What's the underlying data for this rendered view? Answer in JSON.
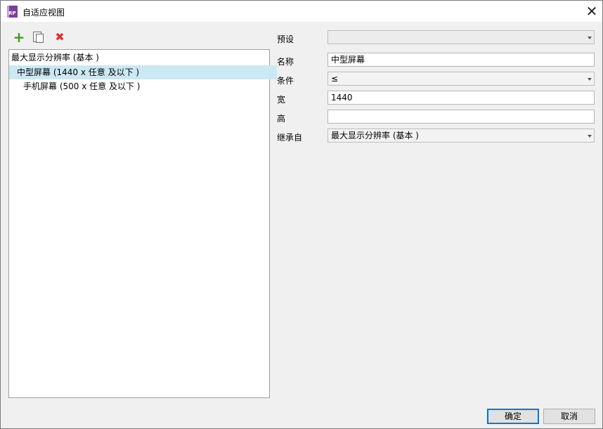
{
  "window": {
    "title": "自适应视图",
    "app_icon_text": "RP"
  },
  "toolbar": {
    "add_icon": "+",
    "copy_icon": "copy-icon",
    "delete_icon": "✖"
  },
  "tree": {
    "items": [
      {
        "label": "最大显示分辨率 (基本 )"
      },
      {
        "label": "中型屏幕 (1440 x 任意  及以下 )",
        "selected": true
      },
      {
        "label": "手机屏幕 (500 x 任意  及以下 )"
      }
    ]
  },
  "form": {
    "preset": {
      "label": "预设",
      "value": ""
    },
    "name": {
      "label": "名称",
      "value": "中型屏幕"
    },
    "condition": {
      "label": "条件",
      "value": "≤"
    },
    "width": {
      "label": "宽",
      "value": "1440"
    },
    "height": {
      "label": "高",
      "value": ""
    },
    "inherit": {
      "label": "继承自",
      "value": "最大显示分辨率 (基本 )"
    }
  },
  "buttons": {
    "ok": "确定",
    "cancel": "取消"
  },
  "colors": {
    "accent": "#0078d7",
    "selection": "#cce8f4",
    "add": "#3f9b1e",
    "delete": "#e03030"
  }
}
